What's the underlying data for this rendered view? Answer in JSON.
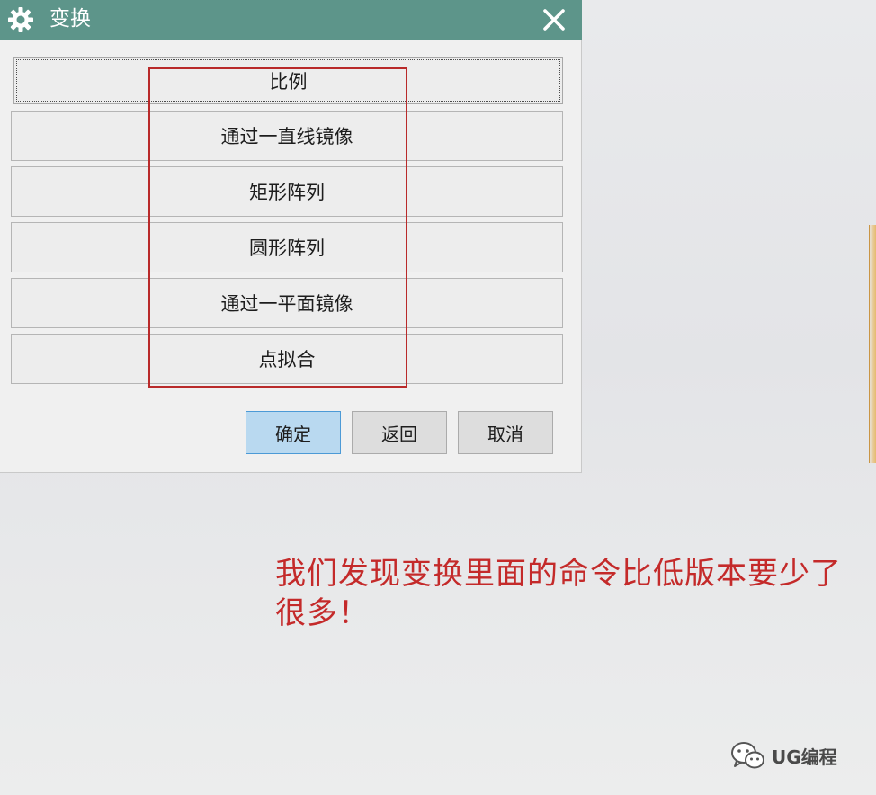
{
  "dialog": {
    "title": "变换",
    "icons": {
      "title": "gear-icon",
      "close": "close-icon"
    },
    "commands": [
      "比例",
      "通过一直线镜像",
      "矩形阵列",
      "圆形阵列",
      "通过一平面镜像",
      "点拟合"
    ],
    "footer": {
      "ok_label": "确定",
      "back_label": "返回",
      "cancel_label": "取消"
    }
  },
  "annotation": {
    "text": "我们发现变换里面的命令比低版本要少了很多！",
    "color": "#c42a2a"
  },
  "watermark": {
    "icon": "wechat-icon",
    "text": "UG编程"
  },
  "colors": {
    "titlebar": "#5d958a",
    "highlight": "#b92a2a",
    "ok_button": "#b9d9f0"
  }
}
